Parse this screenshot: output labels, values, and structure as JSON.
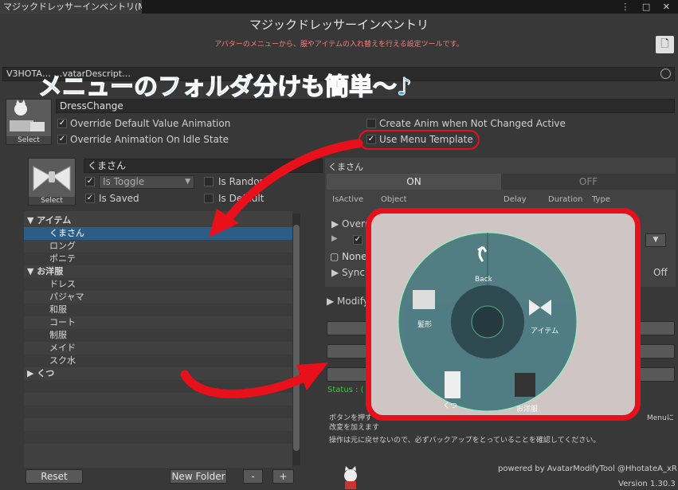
{
  "window": {
    "tab_title": "マジックドレッサーインベントリ(M...",
    "window_icons": "⋮ □ ✕"
  },
  "header": {
    "title": "マジックドレッサーインベントリ",
    "subtitle": "アバターのメニューから、服やアイテムの入れ替えを行える設定ツールです。"
  },
  "avatar_field": {
    "value": "V3HOTA…   …vatarDescript…"
  },
  "banner": {
    "text": "メニューのフォルダ分けも簡単〜♪"
  },
  "menu_settings": {
    "thumb_label": "Select",
    "name": "DressChange",
    "override_default": "Override Default Value Animation",
    "override_idle": "Override Animation On Idle State",
    "create_anim": "Create Anim when Not Changed Active",
    "use_menu_template": "Use Menu Template"
  },
  "item_settings": {
    "thumb_label": "Select",
    "name": "くまさん",
    "toggle_select": "Is Toggle",
    "is_random": "Is Random",
    "is_saved": "Is Saved",
    "is_default": "Is Default"
  },
  "tree": {
    "rows": [
      {
        "label": "▼ アイテム",
        "indent": 4,
        "bold": true
      },
      {
        "label": "くまさん",
        "indent": 32,
        "selected": true
      },
      {
        "label": "ロング",
        "indent": 32
      },
      {
        "label": "ポニテ",
        "indent": 32
      },
      {
        "label": "▼ お洋服",
        "indent": 4,
        "bold": true
      },
      {
        "label": "ドレス",
        "indent": 32
      },
      {
        "label": "パジャマ",
        "indent": 32
      },
      {
        "label": "和服",
        "indent": 32
      },
      {
        "label": "コート",
        "indent": 32
      },
      {
        "label": "制服",
        "indent": 32
      },
      {
        "label": "メイド",
        "indent": 32
      },
      {
        "label": "スク水",
        "indent": 32
      },
      {
        "label": "▶ くつ",
        "indent": 4,
        "bold": true
      }
    ]
  },
  "buttons": {
    "reset": "Reset",
    "new_folder": "New Folder",
    "minus": "-",
    "plus": "+"
  },
  "right_panel": {
    "item_title": "くまさん",
    "tab_on": "ON",
    "tab_off": "OFF",
    "col_isactive": "IsActive",
    "col_object": "Object",
    "col_delay": "Delay",
    "col_duration": "Duration",
    "col_type": "Type",
    "row_override": "Overr",
    "row_none": "None",
    "row_sync": "Sync",
    "off_label": "Off",
    "modify": "Modify",
    "status": "Status : (",
    "note1": "ボタンを押す",
    "note2": "改変を加えます",
    "menu_suffix": "Menuに",
    "warning": "操作は元に戻せないので、必ずバックアップをとっていることを確認してください。"
  },
  "radial_menu": {
    "back": "Back",
    "slot_hair": "髪形",
    "slot_item": "アイテム",
    "slot_shoes": "くつ",
    "slot_clothes": "お洋服"
  },
  "footer": {
    "powered": "powered by AvatarModifyTool @HhotateA_xR",
    "version": "Version 1.30.3"
  }
}
